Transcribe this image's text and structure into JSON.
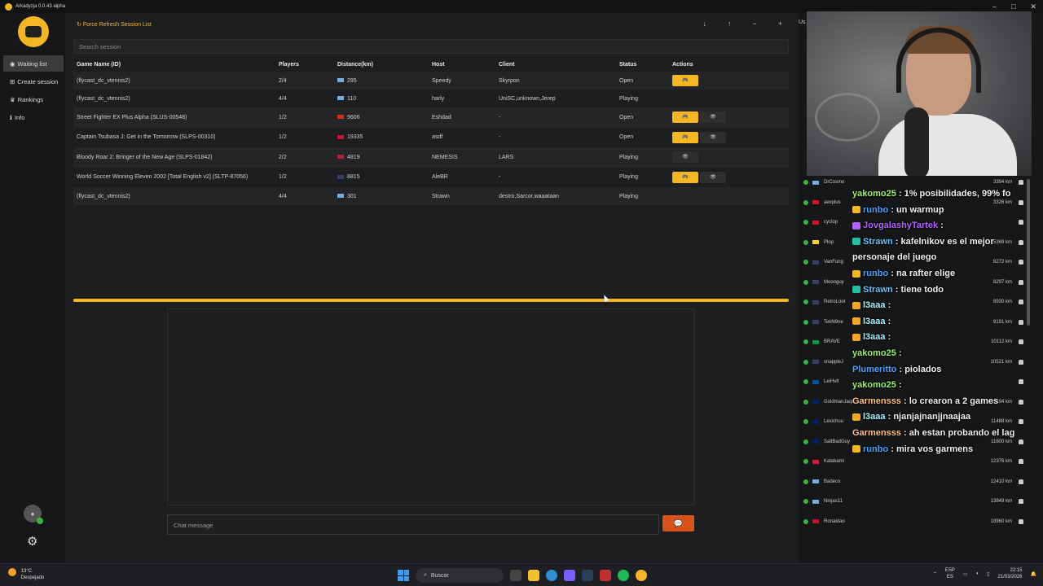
{
  "window": {
    "title": "Arkadyzja 0.0.43 alpha",
    "controls": [
      "–",
      "□",
      "✕"
    ]
  },
  "sidebar": {
    "items": [
      {
        "label": "Waiting list",
        "icon": "globe-icon",
        "active": true
      },
      {
        "label": "Create session",
        "icon": "plus-square-icon",
        "active": false
      },
      {
        "label": "Rankings",
        "icon": "trophy-icon",
        "active": false
      },
      {
        "label": "Info",
        "icon": "info-icon",
        "active": false
      }
    ]
  },
  "main": {
    "refresh_label": "Force Refresh Session List",
    "search_placeholder": "Search session",
    "columns": [
      "Game Name (ID)",
      "Players",
      "Distance(km)",
      "Host",
      "Client",
      "Status",
      "Actions"
    ],
    "rows": [
      {
        "game": "(flycast_dc_vtennis2)",
        "players": "2/4",
        "distance": "295",
        "host": "Speedy",
        "client": "Skyrpon",
        "status": "Open",
        "flag": "#74acdf",
        "join": true,
        "watch": false
      },
      {
        "game": "(flycast_dc_vtennis2)",
        "players": "4/4",
        "distance": "110",
        "host": "harly",
        "client": "UniSC,unknown,Jerep",
        "status": "Playing",
        "flag": "#74acdf",
        "join": false,
        "watch": false
      },
      {
        "game": "Street Fighter EX Plus Alpha (SLUS-00548)",
        "players": "1/2",
        "distance": "9606",
        "host": "Eshdad",
        "client": "-",
        "status": "Open",
        "flag": "#d52b1e",
        "join": true,
        "watch": true
      },
      {
        "game": "Captain Tsubasa J: Get in the Tomorrow (SLPS-00310)",
        "players": "1/2",
        "distance": "19335",
        "host": "asdf",
        "client": "-",
        "status": "Open",
        "flag": "#c8102e",
        "join": true,
        "watch": true
      },
      {
        "game": "Bloody Roar 2: Bringer of the New Age (SLPS-01842)",
        "players": "2/2",
        "distance": "4819",
        "host": "NEMESIS",
        "client": "LARS",
        "status": "Playing",
        "flag": "#b22234",
        "join": false,
        "watch": true
      },
      {
        "game": "World Soccer Winning Eleven 2002 [Total English v2] (SLTP-87056)",
        "players": "1/2",
        "distance": "8815",
        "host": "AleBR",
        "client": "-",
        "status": "Playing",
        "flag": "#3c3b6e",
        "join": true,
        "watch": true
      },
      {
        "game": "(flycast_dc_vtennis2)",
        "players": "4/4",
        "distance": "301",
        "host": "Strawn",
        "client": "destro,Sarcor,waaataan",
        "status": "Playing",
        "flag": "#74acdf",
        "join": false,
        "watch": false
      }
    ],
    "chat_placeholder": "Chat message",
    "send_icon": "chat-bubble-icon"
  },
  "right_panel": {
    "header": "Us",
    "users": [
      {
        "name": "DrCosmo",
        "distance": "3394 km",
        "flag": "#74acdf"
      },
      {
        "name": "aexplus",
        "distance": "3326 km",
        "flag": "#d91023"
      },
      {
        "name": "cyclop",
        "distance": "",
        "flag": "#d91023"
      },
      {
        "name": "Plop",
        "distance": "5369 km",
        "flag": "#fcd116"
      },
      {
        "name": "VanFung",
        "distance": "8272 km",
        "flag": "#3c3b6e"
      },
      {
        "name": "Moooguy",
        "distance": "8297 km",
        "flag": "#3c3b6e"
      },
      {
        "name": "RetroLoot",
        "distance": "8930 km",
        "flag": "#3c3b6e"
      },
      {
        "name": "TekN9ne",
        "distance": "9191 km",
        "flag": "#3c3b6e"
      },
      {
        "name": "BRAVE",
        "distance": "10112 km",
        "flag": "#009739"
      },
      {
        "name": "snappleJ",
        "distance": "10521 km",
        "flag": "#3c3b6e"
      },
      {
        "name": "LeiHvlt",
        "distance": "",
        "flag": "#0055a4"
      },
      {
        "name": "GoldmanJaqs",
        "distance": "11294 km",
        "flag": "#012169"
      },
      {
        "name": "Lexichuu",
        "distance": "11488 km",
        "flag": "#012169"
      },
      {
        "name": "SaltBadGuy",
        "distance": "11600 km",
        "flag": "#012169"
      },
      {
        "name": "Katakami",
        "distance": "12376 km",
        "flag": "#dc143c"
      },
      {
        "name": "Badeco",
        "distance": "12410 km",
        "flag": "#74acdf"
      },
      {
        "name": "Ninjas11",
        "distance": "13849 km",
        "flag": "#74acdf"
      },
      {
        "name": "Ronaldao",
        "distance": "18960 km",
        "flag": "#c8102e"
      }
    ]
  },
  "stream_chat": [
    {
      "user": "yakomo25",
      "text": ": 1% posibilidades, 99% fo",
      "color": "#9cf26a",
      "badge": ""
    },
    {
      "user": "runbo",
      "text": ": un warmup",
      "color": "#4aa3ff",
      "badge": "#f5b623"
    },
    {
      "user": "JovgalashyTartek",
      "text": ":",
      "color": "#b362ff",
      "badge": "#b362ff"
    },
    {
      "user": "Strawn",
      "text": ": kafelnikov es el mejor",
      "color": "#66c0ff",
      "badge": "#20c0a0"
    },
    {
      "user": "",
      "text": "personaje del juego",
      "color": "#f0f0f0",
      "badge": ""
    },
    {
      "user": "runbo",
      "text": ": na rafter elige",
      "color": "#4aa3ff",
      "badge": "#f5b623"
    },
    {
      "user": "Strawn",
      "text": ": tiene todo",
      "color": "#66c0ff",
      "badge": "#20c0a0"
    },
    {
      "user": "l3aaa",
      "text": ":",
      "color": "#a8f0ff",
      "badge": "#f5a623"
    },
    {
      "user": "l3aaa",
      "text": ":",
      "color": "#a8f0ff",
      "badge": "#f5a623"
    },
    {
      "user": "l3aaa",
      "text": ":",
      "color": "#a8f0ff",
      "badge": "#f5a623"
    },
    {
      "user": "yakomo25",
      "text": ":",
      "color": "#9cf26a",
      "badge": ""
    },
    {
      "user": "Plumeritto",
      "text": ": piolados",
      "color": "#4aa3ff",
      "badge": ""
    },
    {
      "user": "yakomo25",
      "text": ":",
      "color": "#9cf26a",
      "badge": ""
    },
    {
      "user": "Garmensss",
      "text": ": lo crearon a 2 games",
      "color": "#ffc080",
      "badge": ""
    },
    {
      "user": "l3aaa",
      "text": ": njanjajnanjjnaajaa",
      "color": "#a8f0ff",
      "badge": "#f5a623"
    },
    {
      "user": "Garmensss",
      "text": ": ah estan probando el lag",
      "color": "#ffc080",
      "badge": ""
    },
    {
      "user": "runbo",
      "text": ": mira vos garmens",
      "color": "#4aa3ff",
      "badge": "#f5b623"
    }
  ],
  "taskbar": {
    "weather_temp": "13°C",
    "weather_desc": "Despejado",
    "search_label": "Buscar",
    "lang_top": "ESP",
    "lang_bottom": "ES",
    "time": "22:15",
    "date": "21/03/2026"
  },
  "colors": {
    "accent": "#f5b623",
    "send": "#d8531c",
    "online": "#3bb34a"
  }
}
